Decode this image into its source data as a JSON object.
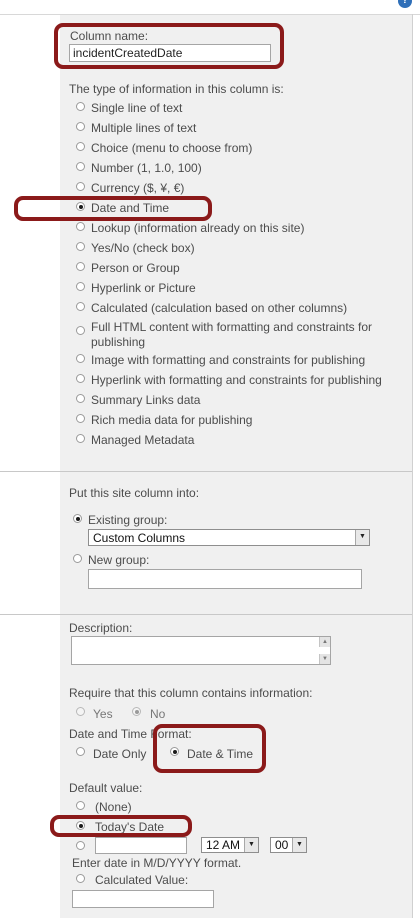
{
  "header": {
    "help_icon": "?"
  },
  "column_name": {
    "label": "Column name:",
    "value": "incidentCreatedDate"
  },
  "type_section": {
    "prompt": "The type of information in this column is:",
    "options": [
      "Single line of text",
      "Multiple lines of text",
      "Choice (menu to choose from)",
      "Number (1, 1.0, 100)",
      "Currency ($, ¥, €)",
      "Date and Time",
      "Lookup (information already on this site)",
      "Yes/No (check box)",
      "Person or Group",
      "Hyperlink or Picture",
      "Calculated (calculation based on other columns)",
      "Full HTML content with formatting and constraints for",
      "publishing",
      "Image with formatting and constraints for publishing",
      "Hyperlink with formatting and constraints for publishing",
      "Summary Links data",
      "Rich media data for publishing",
      "Managed Metadata"
    ],
    "selected": "Date and Time"
  },
  "group_section": {
    "prompt": "Put this site column into:",
    "existing_label": "Existing group:",
    "existing_value": "Custom Columns",
    "new_label": "New group:"
  },
  "description": {
    "label": "Description:"
  },
  "require": {
    "label": "Require that this column contains information:",
    "yes": "Yes",
    "no": "No",
    "selected": "No"
  },
  "format": {
    "label": "Date and Time Format:",
    "date_only": "Date Only",
    "date_time": "Date & Time",
    "selected": "Date & Time"
  },
  "default_value": {
    "label": "Default value:",
    "none": "(None)",
    "today": "Today's Date",
    "hour": "12 AM",
    "minute": "00",
    "hint": "Enter date in M/D/YYYY format.",
    "calculated": "Calculated Value:",
    "selected": "Today's Date"
  },
  "colors": {
    "panel": "#f0f0f0",
    "highlight": "#8b1a1a",
    "help_icon": "#2f6fb8"
  }
}
